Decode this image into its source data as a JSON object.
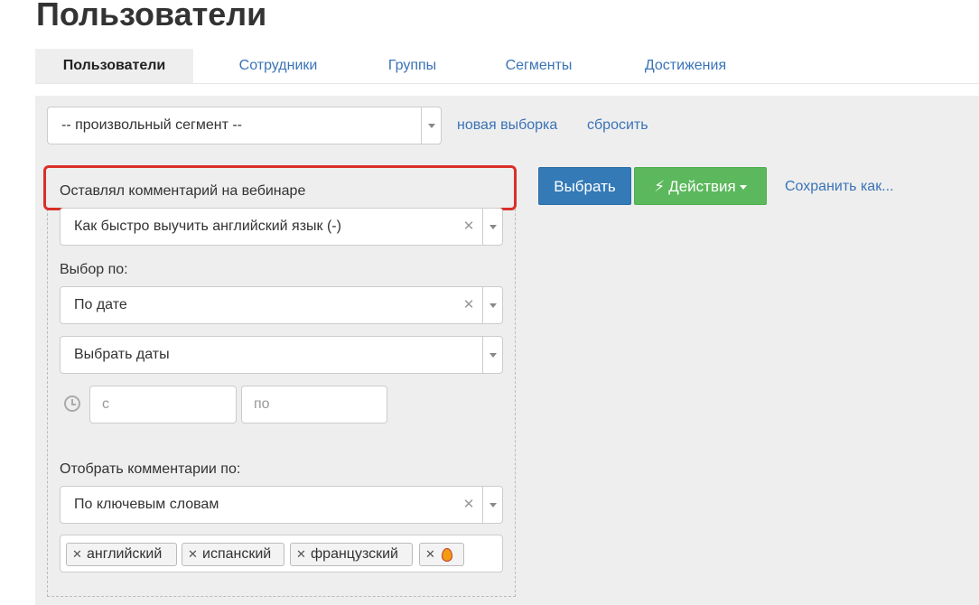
{
  "page": {
    "title": "Пользователи"
  },
  "tabs": [
    {
      "label": "Пользователи",
      "active": true
    },
    {
      "label": "Сотрудники",
      "active": false
    },
    {
      "label": "Группы",
      "active": false
    },
    {
      "label": "Сегменты",
      "active": false
    },
    {
      "label": "Достижения",
      "active": false
    }
  ],
  "segment": {
    "selected": "-- произвольный сегмент --",
    "new_selection_link": "новая выборка",
    "reset_link": "сбросить"
  },
  "filter": {
    "condition_title": "Оставлял комментарий на вебинаре",
    "webinar_select": "Как быстро выучить английский язык (-)",
    "choose_by_label": "Выбор по:",
    "choose_by_select": "По дате",
    "dates_select": "Выбрать даты",
    "date_from_placeholder": "с",
    "date_to_placeholder": "по",
    "comments_filter_label": "Отобрать комментарии по:",
    "comments_filter_select": "По ключевым словам",
    "keywords": [
      "английский",
      "испанский",
      "французский"
    ],
    "emoji_tag_icon": "fire-emoji"
  },
  "actions": {
    "select_button": "Выбрать",
    "actions_button": "Действия",
    "save_as_link": "Сохранить как..."
  },
  "colors": {
    "primary_blue": "#337ab7",
    "success_green": "#5cb85c",
    "highlight_red": "#d9302a",
    "link_blue": "#3a73b7"
  }
}
